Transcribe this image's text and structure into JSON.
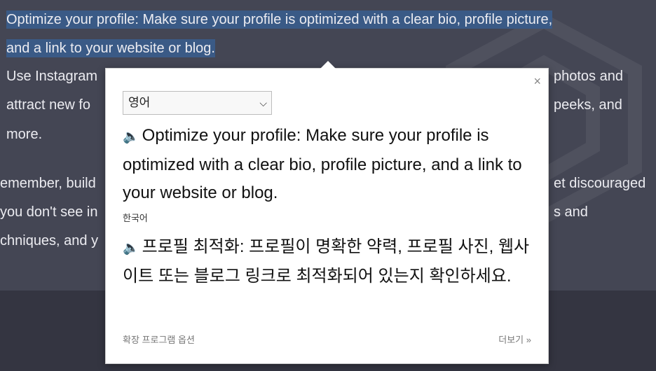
{
  "background": {
    "line1": "Optimize your profile: Make sure your profile is optimized with a clear bio, profile picture,",
    "line2": "and a link to your website or blog.",
    "line3a": "Use Instagram",
    "line3b": "photos and",
    "line4a": "attract new fo",
    "line4b": "peeks, and",
    "line5": "more.",
    "line6a": "emember, build",
    "line6b": "et discouraged",
    "line7a": "you don't see in",
    "line7b": "s and",
    "line8a": "chniques, and y"
  },
  "popup": {
    "close_label": "×",
    "source_language": "영어",
    "dropdown_chevron": "⌵",
    "speaker_glyph": "🔈",
    "source_text": "Optimize your profile: Make sure your profile is optimized with a clear bio, profile picture, and a link to your website or blog.",
    "target_language": "한국어",
    "target_text": "프로필 최적화: 프로필이 명확한 약력, 프로필 사진, 웹사이트 또는 블로그 링크로 최적화되어 있는지 확인하세요.",
    "extension_options": "확장 프로그램 옵션",
    "more_link": "더보기 »"
  },
  "colors": {
    "page_bg": "#444654",
    "bottom_bg": "#343541",
    "highlight": "#3a5a86"
  }
}
